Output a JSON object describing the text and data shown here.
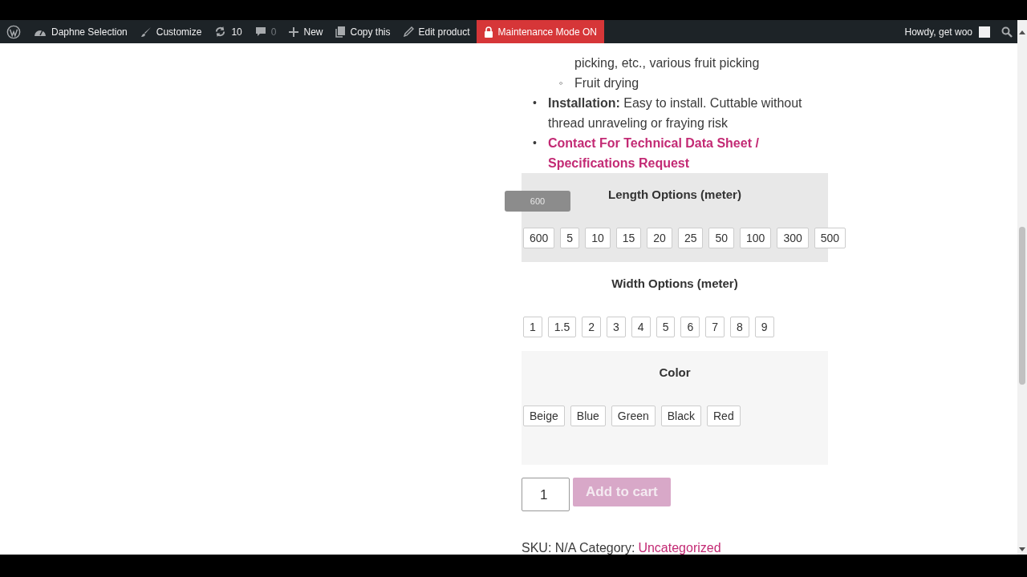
{
  "admin_bar": {
    "items": [
      {
        "kind": "wp"
      },
      {
        "kind": "site",
        "label": "Daphne Selection"
      },
      {
        "kind": "brush",
        "label": "Customize"
      },
      {
        "kind": "updates",
        "label": "10"
      },
      {
        "kind": "comments",
        "label": "0"
      },
      {
        "kind": "new",
        "label": "New"
      },
      {
        "kind": "copy",
        "label": "Copy this"
      },
      {
        "kind": "edit",
        "label": "Edit product"
      },
      {
        "kind": "alert",
        "label": "Maintenance Mode ON"
      }
    ],
    "greeting": "Howdy, get woo"
  },
  "description": {
    "sub_items": [
      {
        "text": "picking, etc., various fruit picking"
      },
      {
        "marker": "◦",
        "text": "Fruit drying"
      }
    ],
    "items": [
      {
        "kind": "text",
        "marker": "•",
        "text": "**Installation:** Easy to install. Cuttable without thread unraveling or fraying risk"
      },
      {
        "kind": "link",
        "marker": "•",
        "text": "**Contact For Technical Data Sheet / Specifications Request**"
      }
    ]
  },
  "options": [
    {
      "title": "Length Options (meter)",
      "color": "#e8e8e8",
      "tooltip": "600",
      "values": [
        "600",
        "5",
        "10",
        "15",
        "20",
        "25",
        "50",
        "100",
        "300",
        "500"
      ]
    },
    {
      "title": "Width Options (meter)",
      "color": "#ffffff",
      "values": [
        "1",
        "1.5",
        "2",
        "3",
        "4",
        "5",
        "6",
        "7",
        "8",
        "9"
      ]
    },
    {
      "title": "Color",
      "color": "#f6f6f6",
      "values": [
        "Beige",
        "Blue",
        "Green",
        "Black",
        "Red"
      ]
    }
  ],
  "quantity": "1",
  "add_to_cart": {
    "label": "Add to cart",
    "disabled": true
  },
  "meta": {
    "sku": "SKU: N/A Category:",
    "category": "Uncategorized"
  }
}
